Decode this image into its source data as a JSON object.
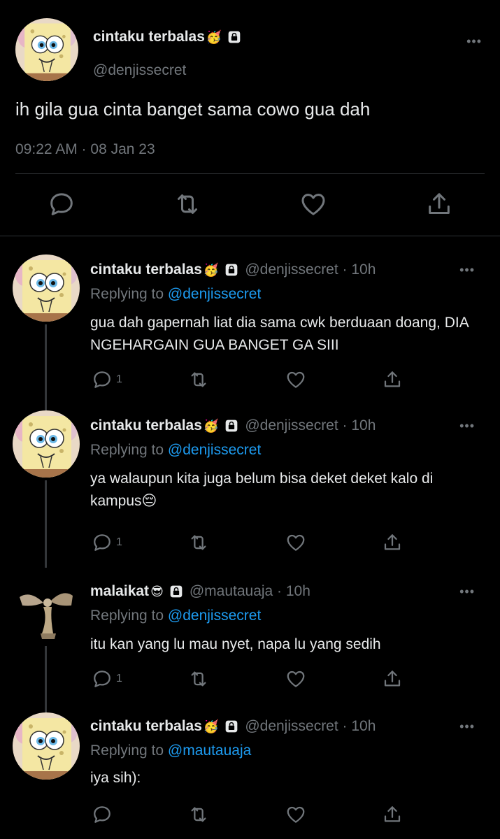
{
  "main_tweet": {
    "display_name": "cintaku terbalas",
    "name_emoji": "🥳",
    "handle": "@denjissecret",
    "text": "ih gila gua cinta banget sama cowo gua dah",
    "timestamp": "09:22 AM · 08 Jan 23",
    "more": "•••"
  },
  "replies": [
    {
      "display_name": "cintaku terbalas",
      "name_emoji": "🥳",
      "handle_time": "@denjissecret · 10h",
      "replying_prefix": "Replying to ",
      "replying_to": "@denjissecret",
      "text": "gua dah gapernah liat dia sama cwk berduaan doang, DIA NGEHARGAIN GUA BANGET GA SIII",
      "reply_count": "1",
      "more": "•••"
    },
    {
      "display_name": "cintaku terbalas",
      "name_emoji": "🥳",
      "handle_time": "@denjissecret · 10h",
      "replying_prefix": "Replying to ",
      "replying_to": "@denjissecret",
      "text": "ya walaupun kita juga belum bisa deket deket kalo di kampus😔",
      "reply_count": "1",
      "more": "•••"
    },
    {
      "display_name": "malaikat",
      "name_emoji": "😎",
      "handle_time": "@mautauaja · 10h",
      "replying_prefix": "Replying to ",
      "replying_to": "@denjissecret",
      "text": "itu kan yang lu mau nyet, napa lu yang sedih",
      "reply_count": "1",
      "more": "•••"
    },
    {
      "display_name": "cintaku terbalas",
      "name_emoji": "🥳",
      "handle_time": "@denjissecret · 10h",
      "replying_prefix": "Replying to ",
      "replying_to": "@mautauaja",
      "text": "iya sih):",
      "reply_count": "",
      "more": "•••"
    }
  ],
  "icons": {
    "reply": "reply-icon",
    "retweet": "retweet-icon",
    "like": "heart-icon",
    "share": "share-icon",
    "lock": "lock-icon",
    "more": "more-icon"
  },
  "colors": {
    "background": "#000000",
    "text": "#e7e9ea",
    "secondary": "#71767b",
    "link": "#1d9bf0",
    "divider": "#2f3336"
  }
}
